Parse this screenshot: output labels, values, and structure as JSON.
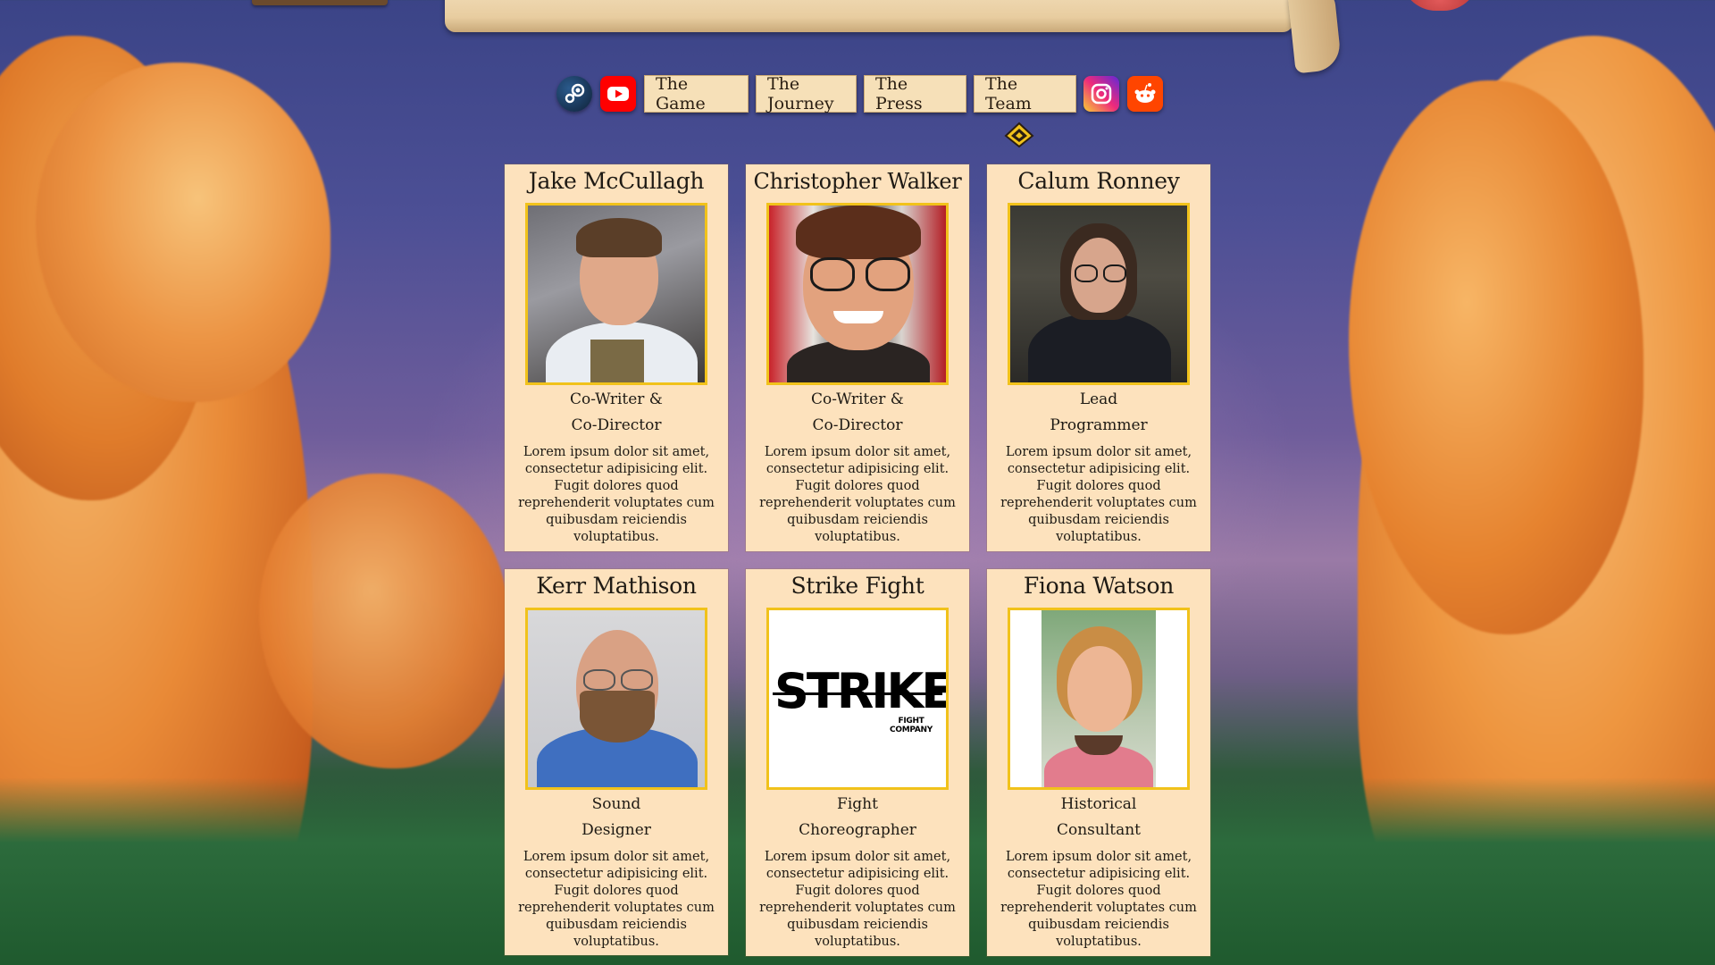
{
  "nav": {
    "icons": [
      "steam-icon",
      "youtube-icon",
      "instagram-icon",
      "reddit-icon"
    ],
    "items": [
      {
        "label": "The Game"
      },
      {
        "label": "The Journey"
      },
      {
        "label": "The Press"
      },
      {
        "label": "The Team"
      }
    ]
  },
  "colors": {
    "card_background": "#fde2bd",
    "photo_border": "#f1c21b",
    "nav_button_background": "#f6e0b8"
  },
  "team": [
    {
      "name": "Jake McCullagh",
      "role_line1": "Co-Writer &",
      "role_line2": "Co-Director",
      "bio": "Lorem ipsum dolor sit amet, consectetur adipisicing elit. Fugit dolores quod reprehenderit voluptates cum quibusdam reiciendis voluptatibus."
    },
    {
      "name": "Christopher Walker",
      "role_line1": "Co-Writer &",
      "role_line2": "Co-Director",
      "bio": "Lorem ipsum dolor sit amet, consectetur adipisicing elit. Fugit dolores quod reprehenderit voluptates cum quibusdam reiciendis voluptatibus."
    },
    {
      "name": "Calum Ronney",
      "role_line1": "Lead",
      "role_line2": "Programmer",
      "bio": "Lorem ipsum dolor sit amet, consectetur adipisicing elit. Fugit dolores quod reprehenderit voluptates cum quibusdam reiciendis voluptatibus."
    },
    {
      "name": "Kerr Mathison",
      "role_line1": "Sound",
      "role_line2": "Designer",
      "bio": "Lorem ipsum dolor sit amet, consectetur adipisicing elit. Fugit dolores quod reprehenderit voluptates cum quibusdam reiciendis voluptatibus."
    },
    {
      "name": "Strike Fight",
      "role_line1": "Fight",
      "role_line2": "Choreographer",
      "bio": "Lorem ipsum dolor sit amet, consectetur adipisicing elit. Fugit dolores quod reprehenderit voluptates cum quibusdam reiciendis voluptatibus.",
      "logo_text": "STRIKE",
      "logo_subtext": "FIGHT COMPANY"
    },
    {
      "name": "Fiona Watson",
      "role_line1": "Historical",
      "role_line2": "Consultant",
      "bio": "Lorem ipsum dolor sit amet, consectetur adipisicing elit. Fugit dolores quod reprehenderit voluptates cum quibusdam reiciendis voluptatibus."
    }
  ]
}
